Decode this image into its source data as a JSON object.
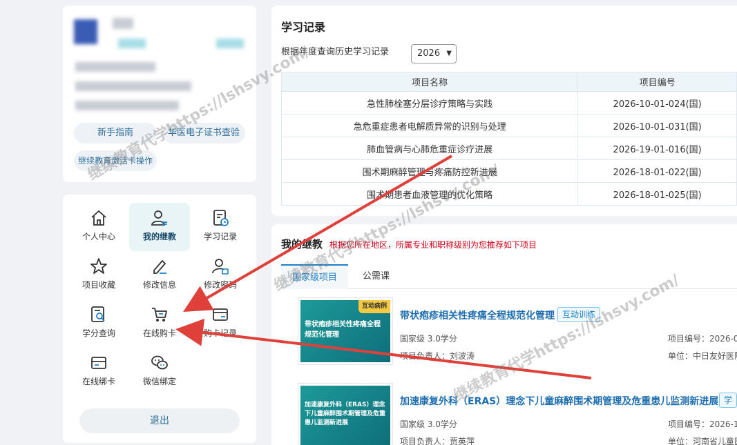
{
  "profile": {
    "buttons": [
      "新手指南",
      "华医电子证书查验",
      "继续教育激活卡操作"
    ]
  },
  "menu": {
    "items": [
      {
        "label": "个人中心",
        "icon": "home-icon"
      },
      {
        "label": "我的继教",
        "icon": "user-card-icon",
        "active": true
      },
      {
        "label": "学习记录",
        "icon": "record-icon"
      },
      {
        "label": "项目收藏",
        "icon": "star-icon"
      },
      {
        "label": "修改信息",
        "icon": "edit-icon"
      },
      {
        "label": "修改密码",
        "icon": "lock-user-icon"
      },
      {
        "label": "学分查询",
        "icon": "search-doc-icon"
      },
      {
        "label": "在线购卡",
        "icon": "cart-icon"
      },
      {
        "label": "购卡记录",
        "icon": "card-icon"
      },
      {
        "label": "在线绑卡",
        "icon": "bind-card-icon"
      },
      {
        "label": "微信绑定",
        "icon": "wechat-icon"
      }
    ],
    "logout": "退出"
  },
  "records": {
    "title": "学习记录",
    "filter_label": "根据年度查询历史学习记录",
    "year": "2026",
    "columns": [
      "项目名称",
      "项目编号"
    ],
    "rows": [
      [
        "急性肺栓塞分层诊疗策略与实践",
        "2026-10-01-024(国)"
      ],
      [
        "急危重症患者电解质异常的识别与处理",
        "2026-10-01-031(国)"
      ],
      [
        "肺血管病与心肺危重症诊疗进展",
        "2026-19-01-016(国)"
      ],
      [
        "围术期麻醉管理与疼痛防控新进展",
        "2026-18-01-022(国)"
      ],
      [
        "围术期患者血液管理的优化策略",
        "2026-18-01-025(国)"
      ]
    ]
  },
  "courses": {
    "title": "我的继教",
    "hint": "根据您所在地区，所属专业和职称级别为您推荐如下项目",
    "tabs": [
      "国家级项目",
      "公需课"
    ],
    "items": [
      {
        "thumb_badge": "互动病例",
        "thumb_text": "带状疱疹相关性疼痛全程规范化管理",
        "name": "带状疱疹相关性疼痛全程规范化管理",
        "tag": "互动训练",
        "credit": "国家级 3.0学分",
        "leader": "项目负责人：刘波涛",
        "code": "项目编号：2026-0",
        "unit": "单位：中日友好医院"
      },
      {
        "thumb_badge": "",
        "thumb_text": "加速康复外科（ERAS）理念下儿童麻醉围术期管理及危重患儿监测新进展",
        "name": "加速康复外科（ERAS）理念下儿童麻醉围术期管理及危重患儿监测新进展",
        "tag": "学",
        "credit": "国家级 3.0学分",
        "leader": "项目负责人：贾英萍",
        "code": "项目编号：2026-1",
        "unit": "单位：河南省儿童医"
      }
    ]
  },
  "watermark": "继续教育代学https://lshsvy.com/",
  "colors": {
    "accent": "#1f7fc4",
    "arrow": "#e0403a",
    "hint": "#d4001a"
  }
}
